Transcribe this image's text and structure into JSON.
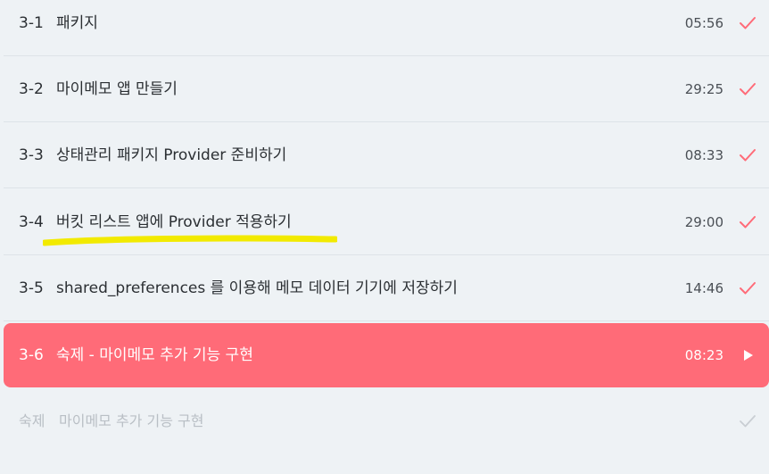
{
  "colors": {
    "background": "#eef2f5",
    "active_row": "#ff6b78",
    "check": "#ff6b78",
    "quiz_check": "#c9ced3",
    "highlight": "#f2ea00"
  },
  "lessons": [
    {
      "num": "3-1",
      "title": "패키지",
      "time": "05:56",
      "status_icon": "check-icon"
    },
    {
      "num": "3-2",
      "title": "마이메모 앱 만들기",
      "time": "29:25",
      "status_icon": "check-icon"
    },
    {
      "num": "3-3",
      "title": "상태관리 패키지 Provider 준비하기",
      "time": "08:33",
      "status_icon": "check-icon"
    },
    {
      "num": "3-4",
      "title": "버킷 리스트 앱에 Provider 적용하기",
      "time": "29:00",
      "status_icon": "check-icon"
    },
    {
      "num": "3-5",
      "title": "shared_preferences 를 이용해 메모 데이터 기기에 저장하기",
      "time": "14:46",
      "status_icon": "check-icon"
    },
    {
      "num": "3-6",
      "title": "숙제 - 마이메모 추가 기능 구현",
      "time": "08:23",
      "status_icon": "play-icon"
    }
  ],
  "quiz": {
    "label": "숙제",
    "title": "마이메모 추가 기능 구현",
    "status_icon": "check-icon"
  }
}
